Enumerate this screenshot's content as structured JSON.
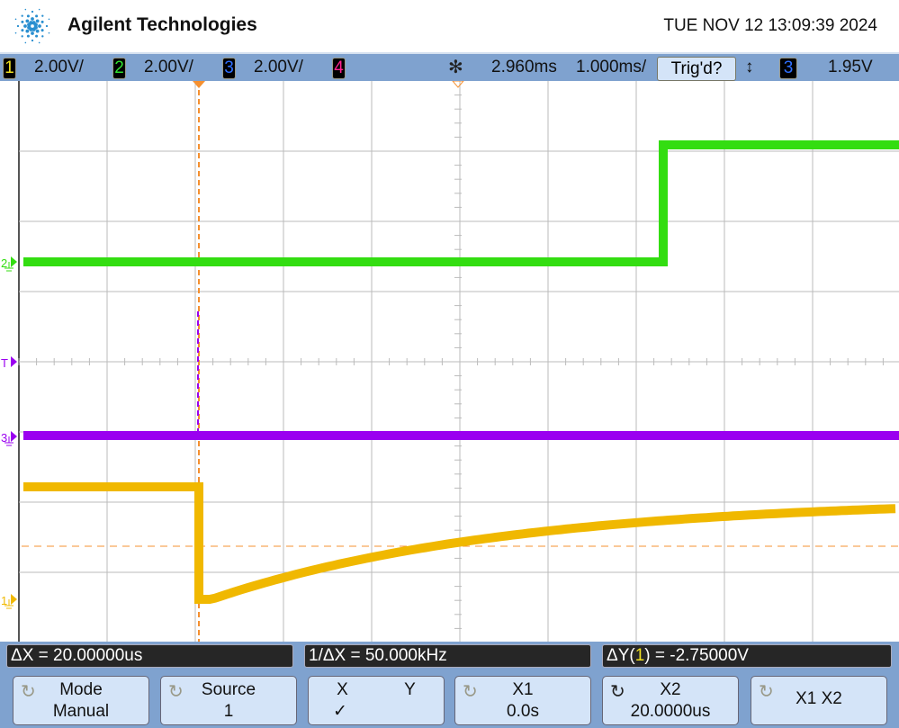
{
  "header": {
    "brand": "Agilent Technologies",
    "datetime": "TUE NOV 12 13:09:39 2024"
  },
  "status_bar": {
    "channels": [
      {
        "num": "1",
        "scale": "2.00V/",
        "color": "#f0e020"
      },
      {
        "num": "2",
        "scale": "2.00V/",
        "color": "#30e030"
      },
      {
        "num": "3",
        "scale": "2.00V/",
        "color": "#3070ff"
      },
      {
        "num": "4",
        "scale": "",
        "color": "#ff2090"
      }
    ],
    "time_delay": "2.960ms",
    "time_scale": "1.000ms/",
    "trigger_status": "Trig'd?",
    "trigger_slope": "↕",
    "trigger_source": "3",
    "trigger_level": "1.95V"
  },
  "graticule": {
    "markers": {
      "ch2": "2",
      "trigger": "T",
      "ch3": "3",
      "ch1": "1"
    },
    "trace_colors": {
      "ch1": "#f0b800",
      "ch2": "#33dd11",
      "ch3": "#9a00f0",
      "cursor": "#f59030"
    }
  },
  "readouts": {
    "delta_x": "ΔX = 20.00000us",
    "inv_delta_x": "1/ΔX = 50.000kHz",
    "delta_y_prefix": "ΔY(",
    "delta_y_ch": "1",
    "delta_y_suffix": ") = -2.75000V"
  },
  "softkeys": [
    {
      "line1": "Mode",
      "line2": "Manual"
    },
    {
      "line1": "Source",
      "line2": "1"
    },
    {
      "x": "X",
      "y": "Y",
      "check": "✓"
    },
    {
      "line1": "X1",
      "line2": "0.0s"
    },
    {
      "line1": "X2",
      "line2": "20.0000us"
    },
    {
      "line1": "X1 X2",
      "line2": ""
    }
  ]
}
